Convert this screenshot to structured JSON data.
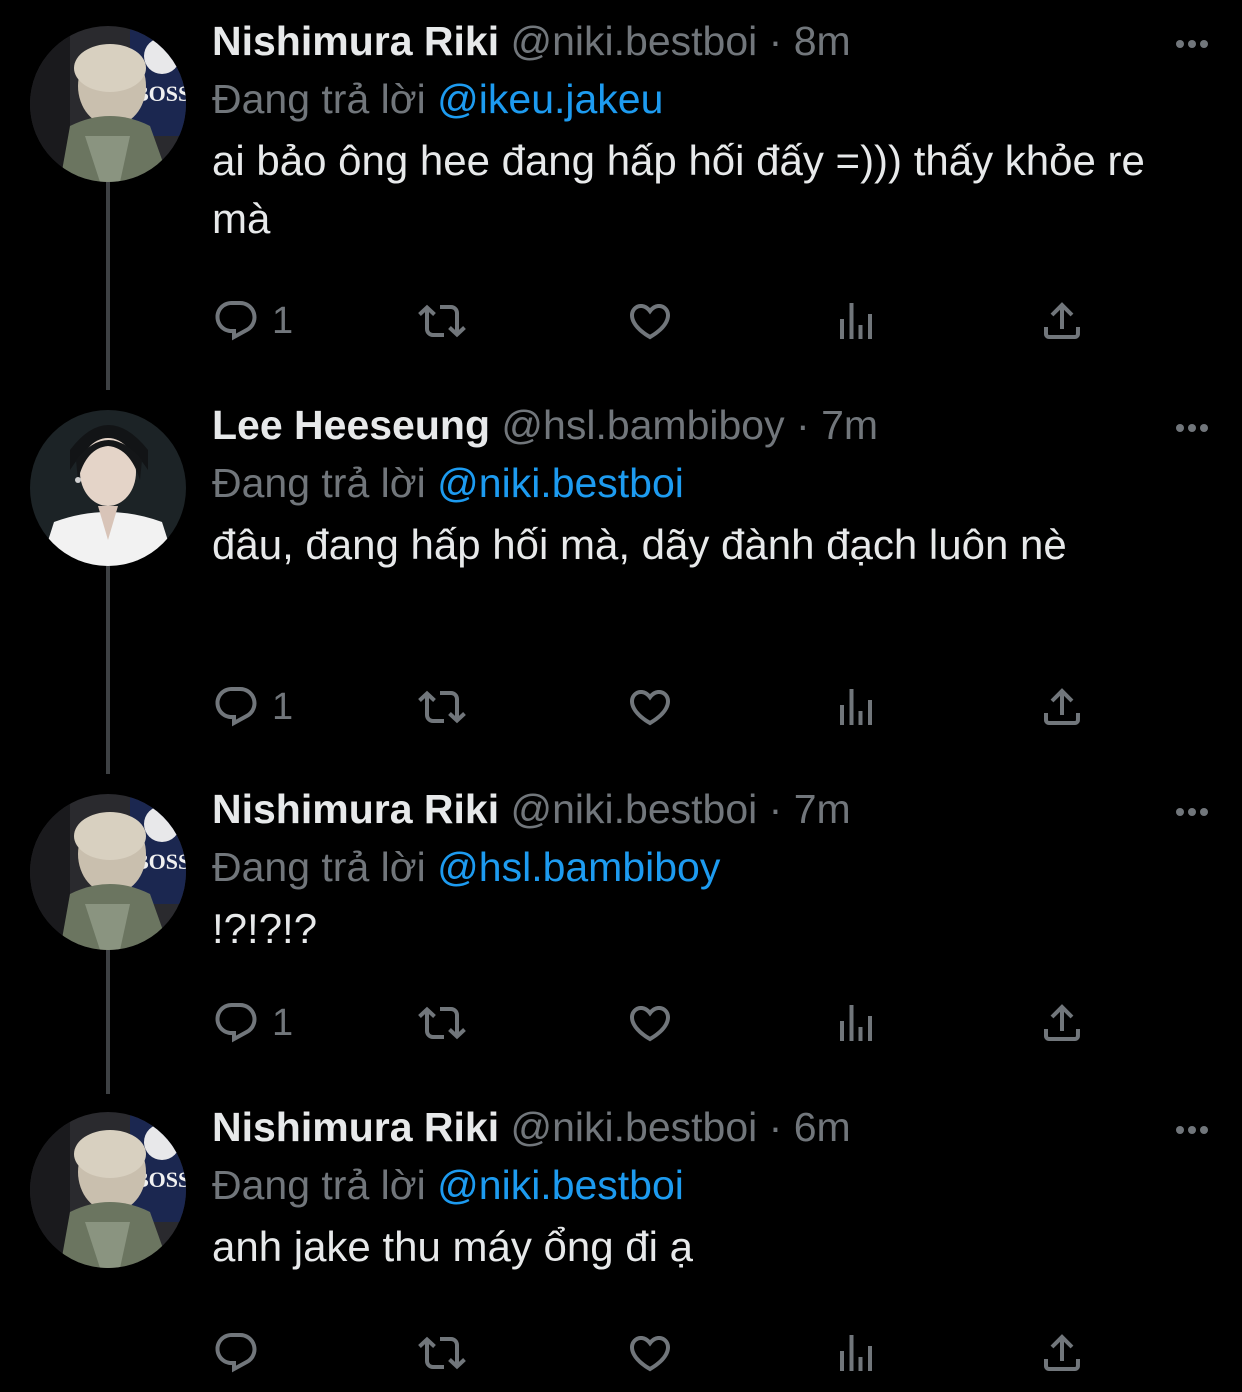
{
  "colors": {
    "background": "#000000",
    "text": "#e7e9ea",
    "muted": "#71767b",
    "accent": "#1d9bf0",
    "thread_line": "#3e4144"
  },
  "tweets": [
    {
      "name": "Nishimura Riki",
      "handle": "@niki.bestboi",
      "separator": "·",
      "time": "8m",
      "reply_prefix": "Đang trả lời",
      "reply_to": "@ikeu.jakeu",
      "text": "ai bảo ông hee đang hấp hối đấy =))) thấy khỏe re mà",
      "reply_count": "1",
      "avatar_icon": "avatar-niki"
    },
    {
      "name": "Lee Heeseung",
      "handle": "@hsl.bambiboy",
      "separator": "·",
      "time": "7m",
      "reply_prefix": "Đang trả lời",
      "reply_to": "@niki.bestboi",
      "text": "đâu, đang hấp hối mà, dãy đành đạch luôn nè",
      "reply_count": "1",
      "avatar_icon": "avatar-heeseung"
    },
    {
      "name": "Nishimura Riki",
      "handle": "@niki.bestboi",
      "separator": "·",
      "time": "7m",
      "reply_prefix": "Đang trả lời",
      "reply_to": "@hsl.bambiboy",
      "text": "!?!?!?",
      "reply_count": "1",
      "avatar_icon": "avatar-niki"
    },
    {
      "name": "Nishimura Riki",
      "handle": "@niki.bestboi",
      "separator": "·",
      "time": "6m",
      "reply_prefix": "Đang trả lời",
      "reply_to": "@niki.bestboi",
      "text": "anh jake thu máy ổng đi ạ",
      "reply_count": "",
      "avatar_icon": "avatar-niki"
    }
  ],
  "icons": {
    "reply": "reply-icon",
    "retweet": "retweet-icon",
    "like": "heart-icon",
    "analytics": "analytics-icon",
    "share": "share-icon",
    "more": "more-icon"
  }
}
